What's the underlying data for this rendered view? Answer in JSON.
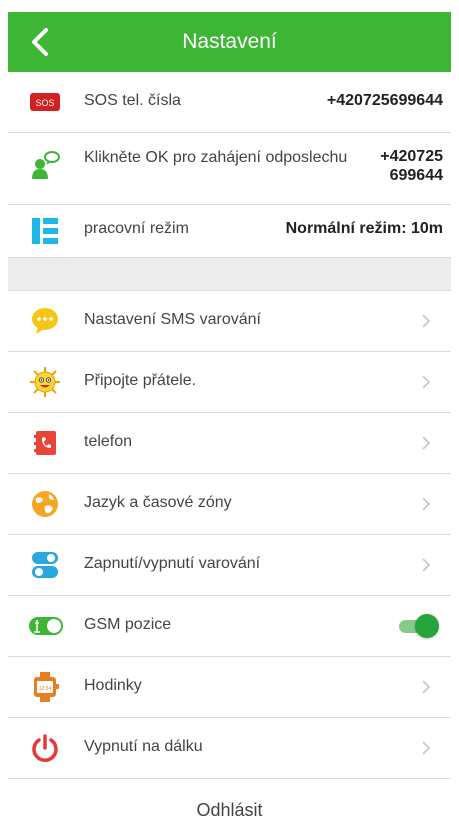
{
  "header": {
    "title": "Nastavení"
  },
  "info_rows": [
    {
      "label": "SOS tel. čísla",
      "value": "+420725699644",
      "icon": "sos-icon",
      "badge": "SOS"
    },
    {
      "label": "Klikněte OK pro zahájení odposlechu",
      "value": "+420725 699644",
      "icon": "listen-person-icon"
    },
    {
      "label": "pracovní režim",
      "value": "Normální režim: 10m",
      "icon": "work-mode-icon"
    }
  ],
  "menu_rows": [
    {
      "label": "Nastavení SMS varování",
      "icon": "sms-chat-icon"
    },
    {
      "label": "Připojte přátele.",
      "icon": "friends-sun-icon"
    },
    {
      "label": "telefon",
      "icon": "phonebook-icon"
    },
    {
      "label": "Jazyk a časové zóny",
      "icon": "globe-icon"
    },
    {
      "label": "Zapnutí/vypnutí varování",
      "icon": "toggles-icon"
    },
    {
      "label": "GSM pozice",
      "icon": "gsm-toggle-icon",
      "toggle_on": true
    },
    {
      "label": "Hodinky",
      "icon": "watch-icon",
      "watch_text": "12:34"
    },
    {
      "label": "Vypnutí na dálku",
      "icon": "power-icon"
    }
  ],
  "logout_label": "Odhlásit",
  "colors": {
    "accent": "#3db535",
    "toggle_on": "#25a43a",
    "power": "#e53935"
  }
}
